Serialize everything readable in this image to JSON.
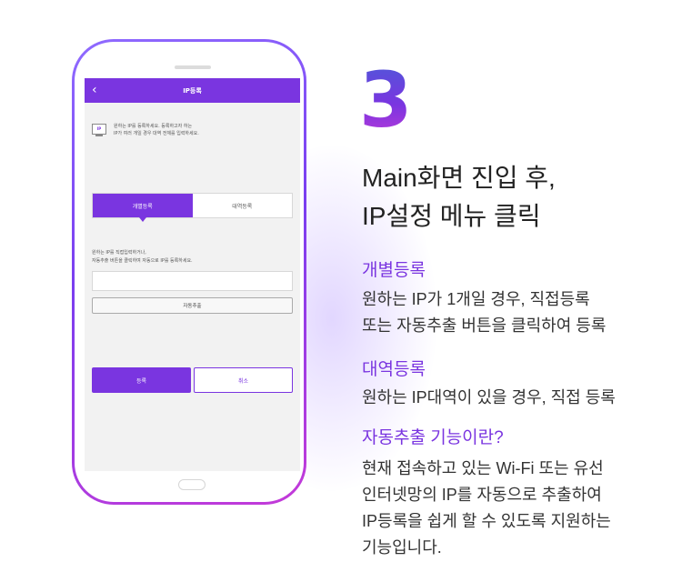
{
  "phone": {
    "screen_title": "IP등록",
    "back_icon": "chevron-left-icon",
    "ip_icon_label": "IP",
    "notice_line1": "원하는 IP를 등록하세요. 등록하고자 하는",
    "notice_line2": "IP가 여러 개일 경우 대역 전체를 입력하세요.",
    "tabs": [
      {
        "label": "개별등록",
        "active": true
      },
      {
        "label": "대역등록",
        "active": false
      }
    ],
    "instruction_line1": "원하는 IP를 직접입력하거나,",
    "instruction_line2": "자동추출 버튼을 클릭하여 자동으로 IP를 등록하세요.",
    "input_value": "",
    "auto_extract_label": "자동추출",
    "register_label": "등록",
    "cancel_label": "취소"
  },
  "guide": {
    "step": "3",
    "headline_line1": "Main화면 진입 후,",
    "headline_line2": "IP설정 메뉴 클릭",
    "sections": [
      {
        "title": "개별등록",
        "lines": [
          "원하는 IP가 1개일 경우, 직접등록",
          "또는 자동추출 버튼을 클릭하여 등록"
        ]
      },
      {
        "title": "대역등록",
        "lines": [
          "원하는 IP대역이 있을 경우, 직접 등록"
        ]
      },
      {
        "title": "자동추출 기능이란?",
        "lines": [
          "현재 접속하고 있는 Wi-Fi 또는 유선",
          "인터넷망의 IP를 자동으로 추출하여",
          "IP등록을 쉽게 할 수 있도록 지원하는",
          "기능입니다."
        ]
      }
    ]
  },
  "colors": {
    "brand_purple": "#7a35e0",
    "gradient_blue": "#4b5bd8",
    "gradient_magenta": "#c03ad8"
  }
}
